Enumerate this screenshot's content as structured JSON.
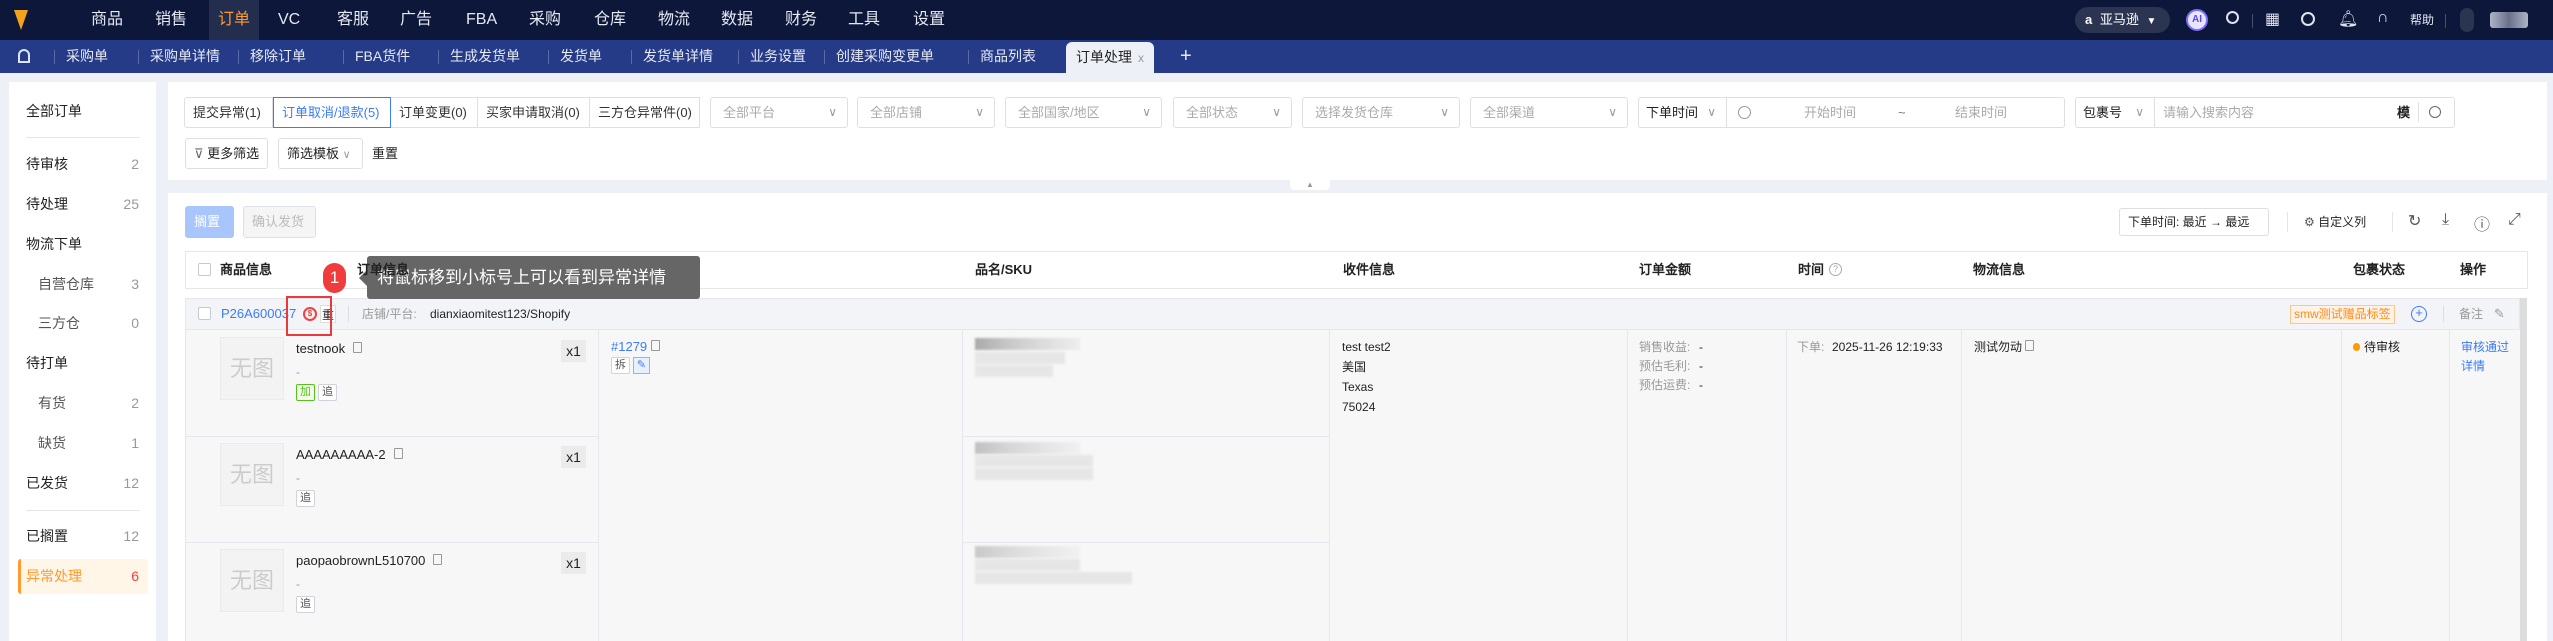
{
  "topnav": {
    "items": [
      "商品",
      "销售",
      "订单",
      "VC",
      "客服",
      "广告",
      "FBA",
      "采购",
      "仓库",
      "物流",
      "数据",
      "财务",
      "工具",
      "设置"
    ],
    "active": "订单",
    "platform": "亚马逊",
    "ai": "AI",
    "help": "帮助",
    "icons": [
      "logo-fox-icon",
      "amazon-icon",
      "ai-icon",
      "search-icon",
      "grid-icon",
      "download-icon",
      "bell-icon",
      "headset-icon",
      "user-icon"
    ]
  },
  "tabbar": {
    "items": [
      "采购单",
      "采购单详情",
      "移除订单",
      "FBA货件",
      "生成发货单",
      "发货单",
      "发货单详情",
      "业务设置",
      "创建采购变更单",
      "商品列表"
    ],
    "active": "订单处理",
    "close": "x",
    "add": "+"
  },
  "sidebar": {
    "items": [
      {
        "label": "全部订单",
        "count": ""
      },
      {
        "label": "待审核",
        "count": "2"
      },
      {
        "label": "待处理",
        "count": "25"
      },
      {
        "label": "物流下单",
        "count": ""
      },
      {
        "label": "自营仓库",
        "count": "3"
      },
      {
        "label": "三方仓",
        "count": "0"
      },
      {
        "label": "待打单",
        "count": ""
      },
      {
        "label": "有货",
        "count": "2"
      },
      {
        "label": "缺货",
        "count": "1"
      },
      {
        "label": "已发货",
        "count": "12"
      },
      {
        "label": "已搁置",
        "count": "12"
      },
      {
        "label": "异常处理",
        "count": "6"
      }
    ],
    "active": "异常处理",
    "accent": "#ff9a2e"
  },
  "filters": {
    "tabs": [
      "提交异常(1)",
      "订单取消/退款(5)",
      "订单变更(0)",
      "买家申请取消(0)",
      "三方仓异常件(0)"
    ],
    "active_tab": 1,
    "selects": [
      "全部平台",
      "全部店铺",
      "全部国家/地区",
      "全部状态",
      "选择发货仓库",
      "全部渠道"
    ],
    "time_type": "下单时间",
    "start_placeholder": "开始时间",
    "tilde": "~",
    "end_placeholder": "结束时间",
    "search_type": "包裹号",
    "search_placeholder": "请输入搜索内容",
    "fuzzy": "模",
    "more": "更多筛选",
    "template": "筛选模板",
    "reset": "重置"
  },
  "toolbar": {
    "shelve": "搁置",
    "confirm_ship": "确认发货",
    "sort": "下单时间:  最近 → 最远",
    "custom_columns": "自定义列"
  },
  "table": {
    "headers": [
      "商品信息",
      "订单信息",
      "品名/SKU",
      "收件信息",
      "订单金额",
      "时间",
      "物流信息",
      "包裹状态",
      "操作"
    ]
  },
  "tooltip": {
    "step": "1",
    "text": "将鼠标移到小标号上可以看到异常详情"
  },
  "order": {
    "id": "P26A600037",
    "repeat_tag": "重",
    "shop_label": "店铺/平台:",
    "shop": "dianxiaomitest123/Shopify",
    "label_tag": "smw测试赠品标签",
    "remark": "备注",
    "products": [
      {
        "name": "testnook",
        "dash": "-",
        "tags": [
          "加",
          "追"
        ],
        "qty": "x1",
        "noimg": "无图"
      },
      {
        "name": "AAAAAAAAA-2",
        "dash": "-",
        "tags": [
          "追"
        ],
        "qty": "x1",
        "noimg": "无图"
      },
      {
        "name": "paopaobrownL510700",
        "dash": "-",
        "tags": [
          "追"
        ],
        "qty": "x1",
        "noimg": "无图"
      }
    ],
    "order_no": "#1279",
    "order_tags": [
      "拆"
    ],
    "recipient": [
      "test test2",
      "美国",
      "Texas",
      "75024"
    ],
    "amount": [
      {
        "label": "销售收益:",
        "value": "-"
      },
      {
        "label": "预估毛利:",
        "value": "-"
      },
      {
        "label": "预估运费:",
        "value": "-"
      }
    ],
    "time_label": "下单:",
    "time": "2025-11-26 12:19:33",
    "logistics": "测试勿动",
    "status": "待审核",
    "status_color": "#ff9a00",
    "actions": [
      "审核通过",
      "详情"
    ]
  }
}
